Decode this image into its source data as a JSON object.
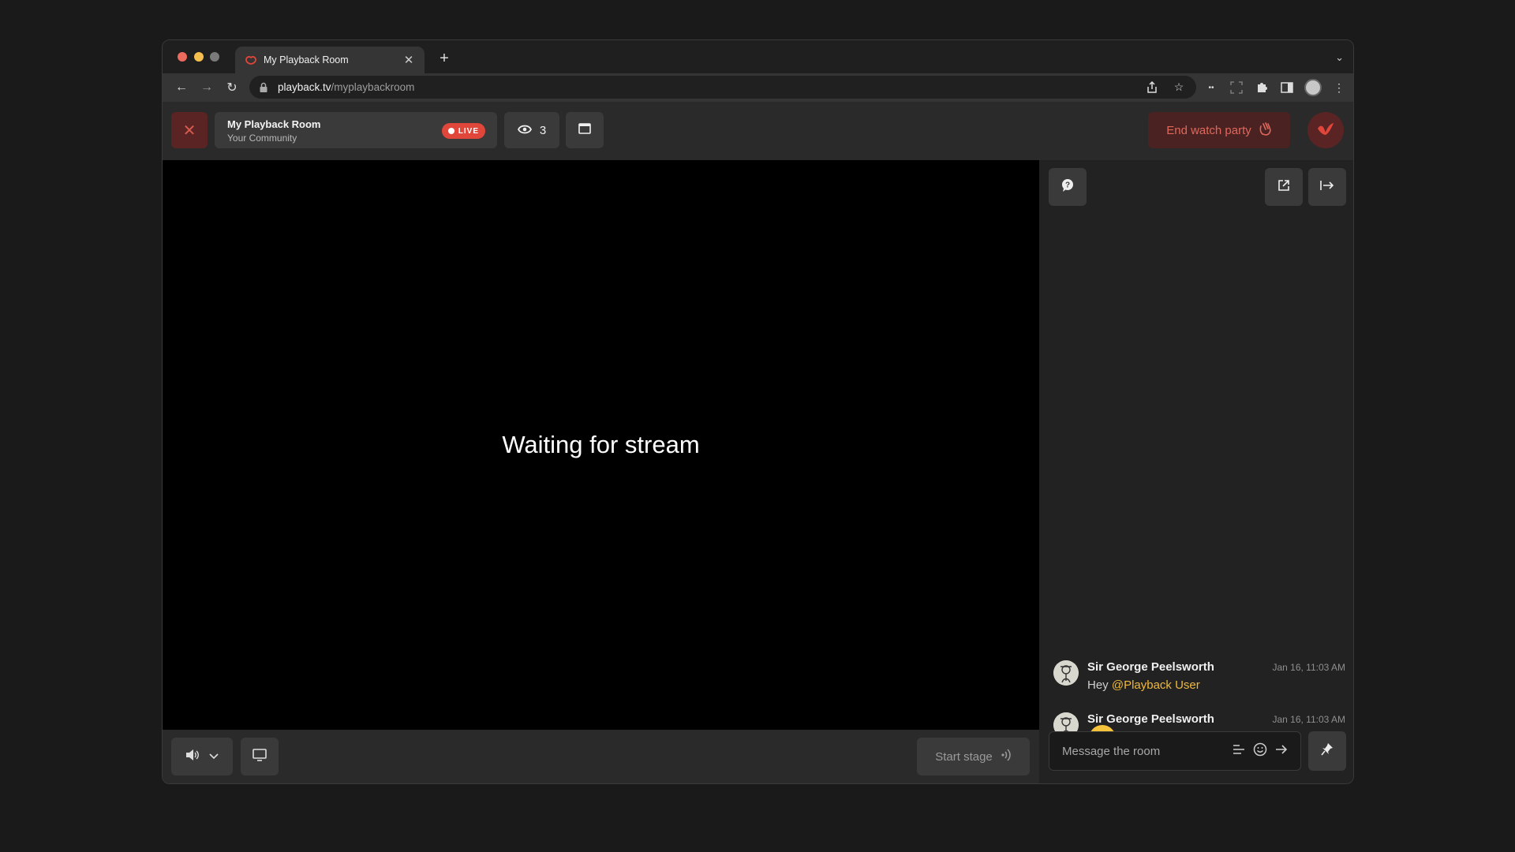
{
  "browser": {
    "tab_title": "My Playback Room",
    "new_tab_label": "+",
    "url_domain": "playback.tv",
    "url_path": "/myplaybackroom"
  },
  "header": {
    "room_name": "My Playback Room",
    "room_community": "Your Community",
    "live_label": "LIVE",
    "viewer_count": "3",
    "end_party_label": "End watch party"
  },
  "video": {
    "status_text": "Waiting for stream",
    "start_stage_label": "Start stage"
  },
  "chat": {
    "messages": [
      {
        "author": "Sir George Peelsworth",
        "time": "Jan 16, 11:03 AM",
        "text_prefix": "Hey ",
        "mention": "@Playback User"
      },
      {
        "author": "Sir George Peelsworth",
        "time": "Jan 16, 11:03 AM",
        "emoji": "grinning-face"
      }
    ],
    "composer_placeholder": "Message the room"
  },
  "colors": {
    "accent_red": "#e0463a",
    "mention_yellow": "#f0b93a",
    "app_bg": "#222222",
    "video_bg": "#000000"
  }
}
